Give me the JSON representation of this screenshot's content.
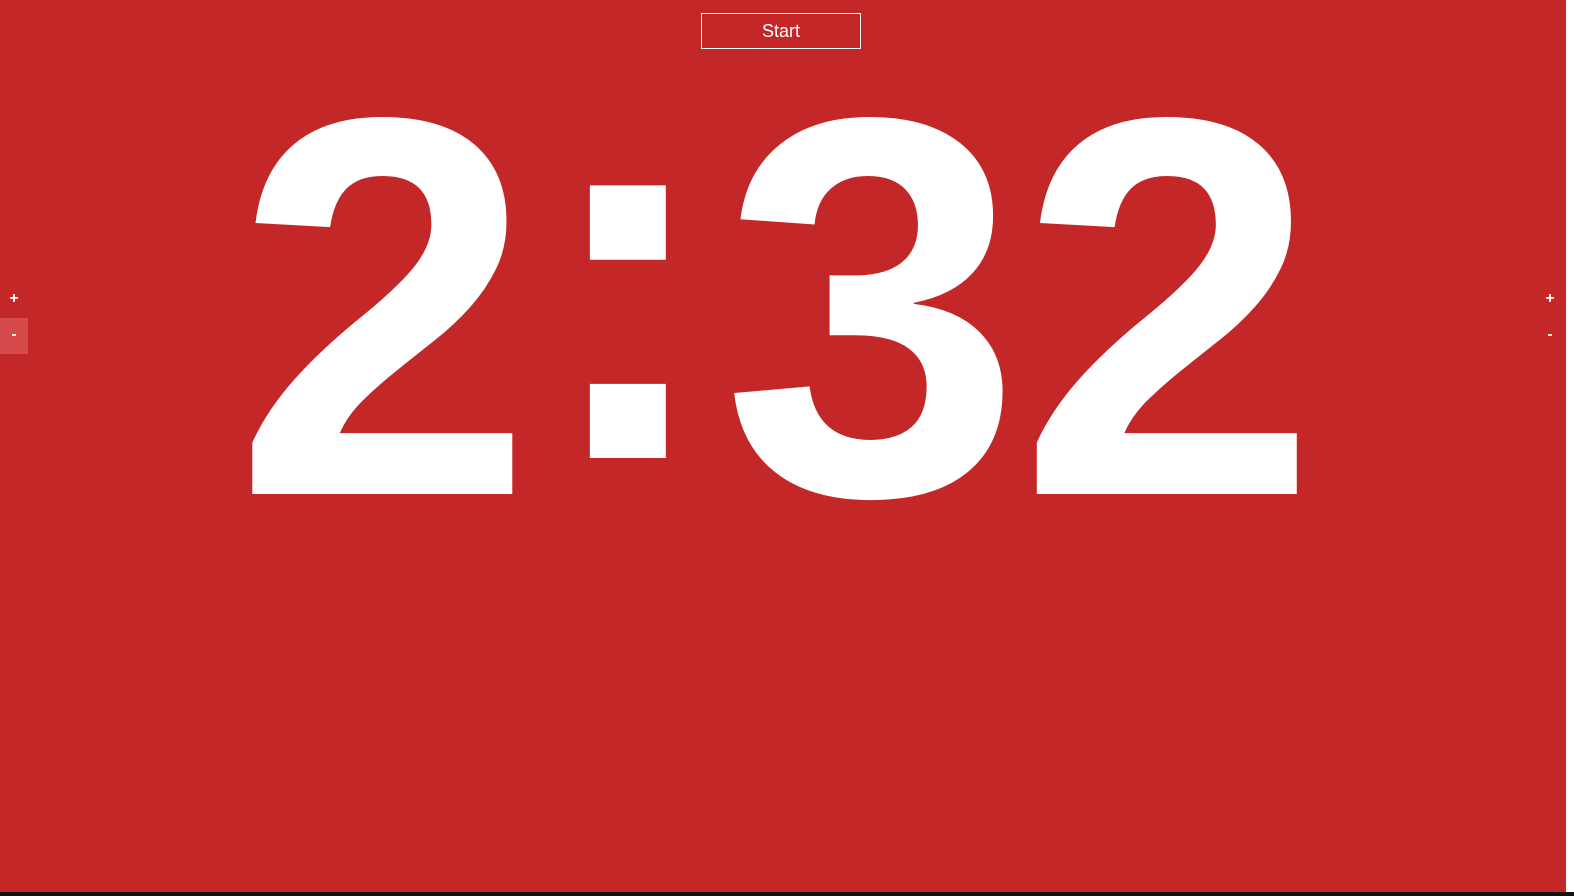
{
  "controls": {
    "start_label": "Start"
  },
  "timer": {
    "minutes": "2",
    "separator": ":",
    "seconds": "32"
  },
  "minutes_adjust": {
    "increase_label": "+",
    "decrease_label": "-"
  },
  "seconds_adjust": {
    "increase_label": "+",
    "decrease_label": "-"
  },
  "colors": {
    "background": "#c42727",
    "foreground": "#ffffff",
    "hover": "#d44a4a"
  }
}
